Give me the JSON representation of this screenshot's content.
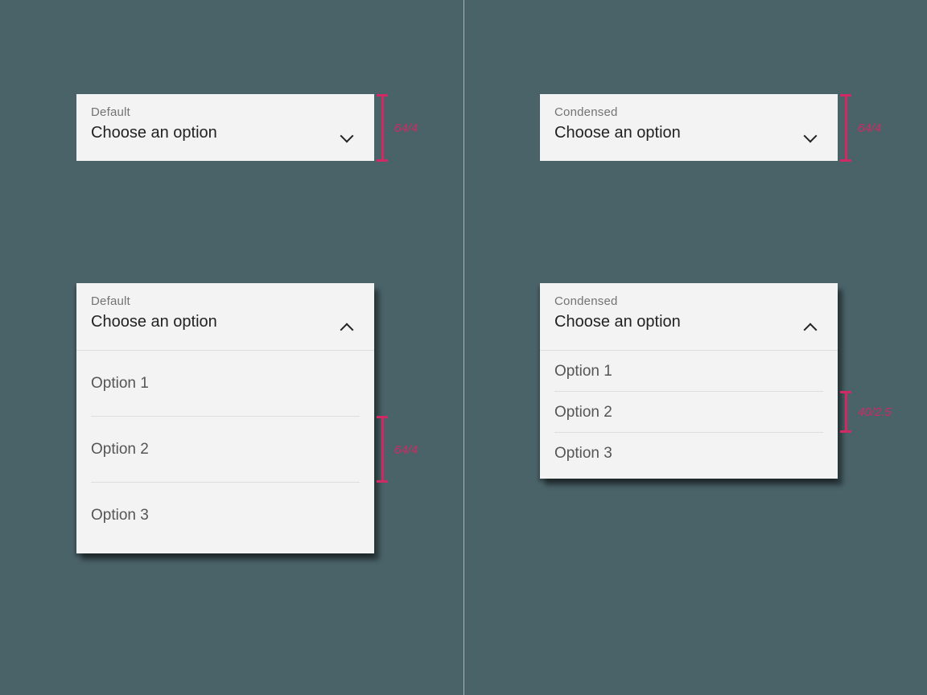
{
  "left": {
    "closed": {
      "label": "Default",
      "value": "Choose an option",
      "measure": "64/4"
    },
    "open": {
      "label": "Default",
      "value": "Choose an option",
      "options": [
        "Option 1",
        "Option 2",
        "Option 3"
      ],
      "measure": "64/4"
    }
  },
  "right": {
    "closed": {
      "label": "Condensed",
      "value": "Choose an option",
      "measure": "64/4"
    },
    "open": {
      "label": "Condensed",
      "value": "Choose an option",
      "options": [
        "Option 1",
        "Option 2",
        "Option 3"
      ],
      "measure": "40/2.5"
    }
  }
}
